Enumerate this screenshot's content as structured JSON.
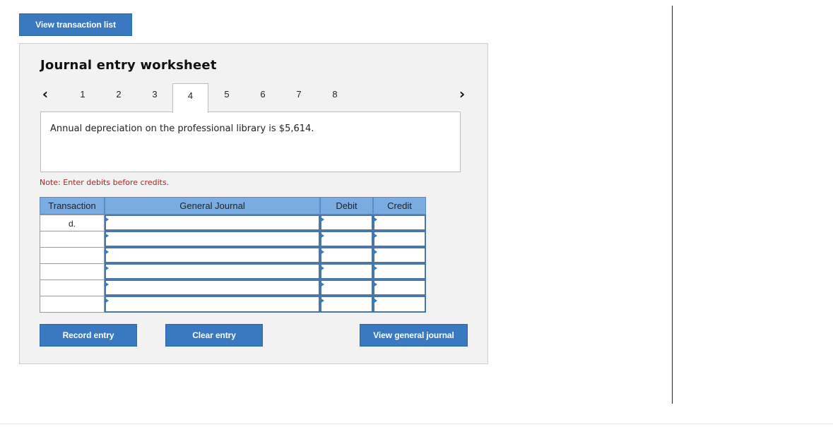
{
  "toolbar": {
    "view_transaction_list": "View transaction list"
  },
  "worksheet": {
    "title": "Journal entry worksheet",
    "nav": {
      "prev_icon": "chevron-left-icon",
      "next_icon": "chevron-right-icon"
    },
    "tabs": [
      "1",
      "2",
      "3",
      "4",
      "5",
      "6",
      "7",
      "8"
    ],
    "active_tab": "4",
    "description": "Annual depreciation on the professional library is $5,614.",
    "note": "Note: Enter debits before credits.",
    "table": {
      "headers": {
        "transaction": "Transaction",
        "general_journal": "General Journal",
        "debit": "Debit",
        "credit": "Credit"
      },
      "rows": [
        {
          "transaction": "d.",
          "account": "",
          "debit": "",
          "credit": ""
        },
        {
          "transaction": "",
          "account": "",
          "debit": "",
          "credit": ""
        },
        {
          "transaction": "",
          "account": "",
          "debit": "",
          "credit": ""
        },
        {
          "transaction": "",
          "account": "",
          "debit": "",
          "credit": ""
        },
        {
          "transaction": "",
          "account": "",
          "debit": "",
          "credit": ""
        },
        {
          "transaction": "",
          "account": "",
          "debit": "",
          "credit": ""
        }
      ]
    },
    "buttons": {
      "record": "Record entry",
      "clear": "Clear entry",
      "view_general_journal": "View general journal"
    }
  },
  "colors": {
    "button_blue": "#3a78c0",
    "header_blue": "#7aace2",
    "note_red": "#a3282a",
    "panel_bg": "#f2f2f2"
  }
}
